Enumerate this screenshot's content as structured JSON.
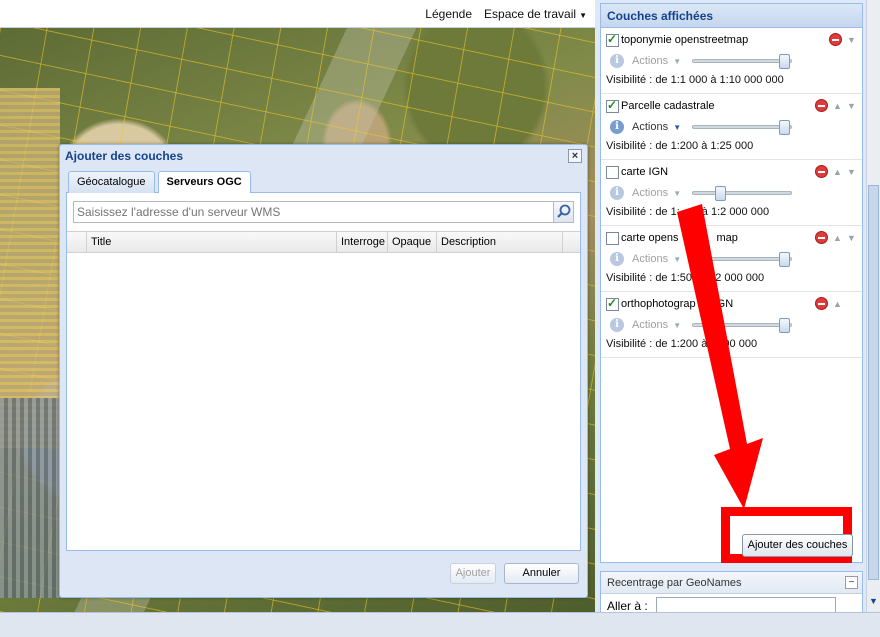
{
  "map_toolbar": {
    "legend": "Légende",
    "workspace": "Espace de travail"
  },
  "layers_panel": {
    "title": "Couches affichées",
    "layers": [
      {
        "name": "toponymie openstreetmap",
        "checked": true,
        "actions": "Actions",
        "visibility": "Visibilité : de 1:1 000 à 1:10 000 000",
        "opacity": 1.0
      },
      {
        "name": "Parcelle cadastrale",
        "checked": true,
        "actions": "Actions",
        "visibility": "Visibilité : de 1:200 à 1:25 000",
        "opacity": 1.0
      },
      {
        "name": "carte IGN",
        "checked": false,
        "actions": "Actions",
        "visibility": "Visibilité : de 1:",
        "visibility_end": "à 1:2 000 000",
        "opacity": 0.3
      },
      {
        "name": "carte opens",
        "name_end": "map",
        "checked": false,
        "actions": "Actions",
        "visibility": "Visibilité : de 1:50",
        "visibility_end": "1:2 000 000",
        "opacity": 1.0
      },
      {
        "name": "orthophotograp",
        "name_end": "IGN",
        "checked": true,
        "actions": "Actions",
        "visibility": "Visibilité : de 1:200 à",
        "visibility_end": "000 000",
        "opacity": 1.0
      }
    ]
  },
  "add_layers_button": "Ajouter des couches",
  "geonames_panel": {
    "title": "Recentrage par GeoNames",
    "label": "Aller à :",
    "value": ""
  },
  "dialog": {
    "title": "Ajouter des couches",
    "close": "×",
    "tabs": [
      "Géocatalogue",
      "Serveurs OGC"
    ],
    "active_tab": "Serveurs OGC",
    "search_placeholder": "Saisissez l'adresse d'un serveur WMS",
    "columns": [
      "Title",
      "Interroge",
      "Opaque",
      "Description"
    ],
    "rows": [],
    "add_button": "Ajouter",
    "cancel_button": "Annuler"
  },
  "colors": {
    "highlight": "#ff0000",
    "panel_header": "#15428b",
    "panel_border": "#99bbe8"
  }
}
